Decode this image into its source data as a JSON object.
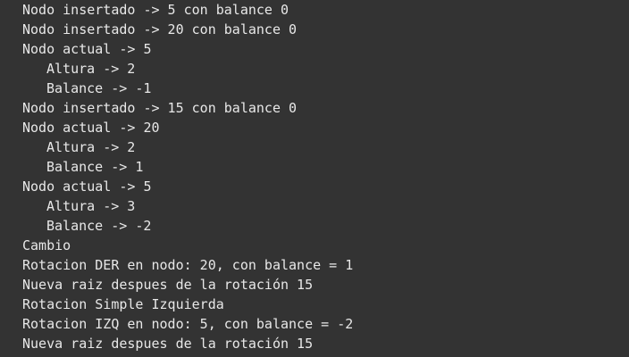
{
  "console": {
    "lines": [
      {
        "text": "Nodo insertado -> 5 con balance 0",
        "indent": false
      },
      {
        "text": "Nodo insertado -> 20 con balance 0",
        "indent": false
      },
      {
        "text": "Nodo actual -> 5",
        "indent": false
      },
      {
        "text": "Altura -> 2",
        "indent": true
      },
      {
        "text": "Balance -> -1",
        "indent": true
      },
      {
        "text": "Nodo insertado -> 15 con balance 0",
        "indent": false
      },
      {
        "text": "Nodo actual -> 20",
        "indent": false
      },
      {
        "text": "Altura -> 2",
        "indent": true
      },
      {
        "text": "Balance -> 1",
        "indent": true
      },
      {
        "text": "Nodo actual -> 5",
        "indent": false
      },
      {
        "text": "Altura -> 3",
        "indent": true
      },
      {
        "text": "Balance -> -2",
        "indent": true
      },
      {
        "text": "Cambio",
        "indent": false
      },
      {
        "text": "Rotacion DER en nodo: 20, con balance = 1",
        "indent": false
      },
      {
        "text": "Nueva raiz despues de la rotación 15",
        "indent": false
      },
      {
        "text": "Rotacion Simple Izquierda",
        "indent": false
      },
      {
        "text": "Rotacion IZQ en nodo: 5, con balance = -2",
        "indent": false
      },
      {
        "text": "Nueva raiz despues de la rotación 15",
        "indent": false
      }
    ]
  },
  "colors": {
    "background": "#333333",
    "text": "#e8e8e8"
  }
}
